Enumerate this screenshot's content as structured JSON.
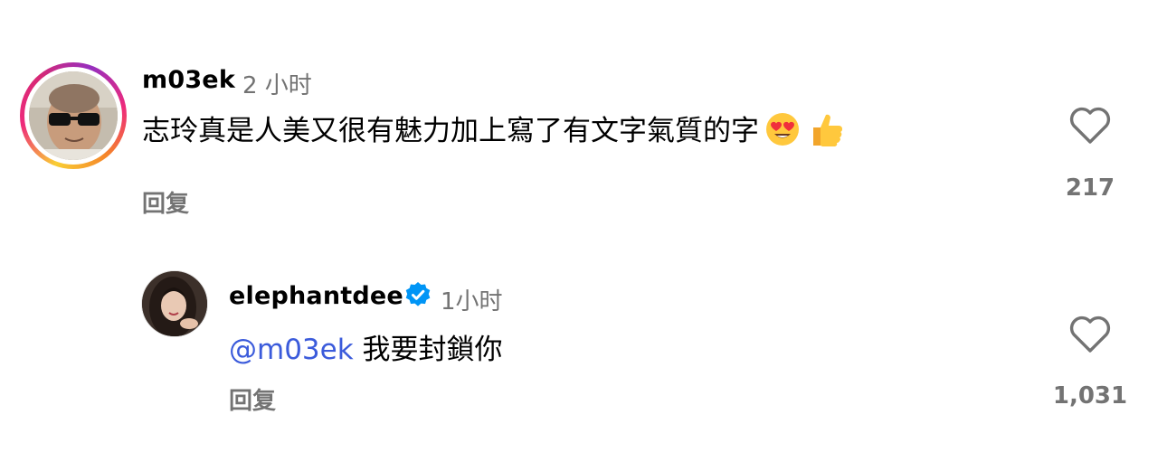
{
  "comments": [
    {
      "username": "m03ek",
      "timestamp": "2 小时",
      "text": "志玲真是人美又很有魅力加上寫了有文字氣質的字",
      "emojis": [
        "heart-eyes-emoji",
        "thumbs-up-emoji"
      ],
      "reply_label": "回复",
      "like_count": "217",
      "has_story_ring": true
    },
    {
      "username": "elephantdee",
      "verified": true,
      "timestamp": "1小时",
      "mention": "@m03ek",
      "text": "我要封鎖你",
      "reply_label": "回复",
      "like_count": "1,031"
    }
  ],
  "colors": {
    "mention": "#3b5bdb",
    "secondary_text": "#737373",
    "verified_badge": "#0095f6"
  }
}
